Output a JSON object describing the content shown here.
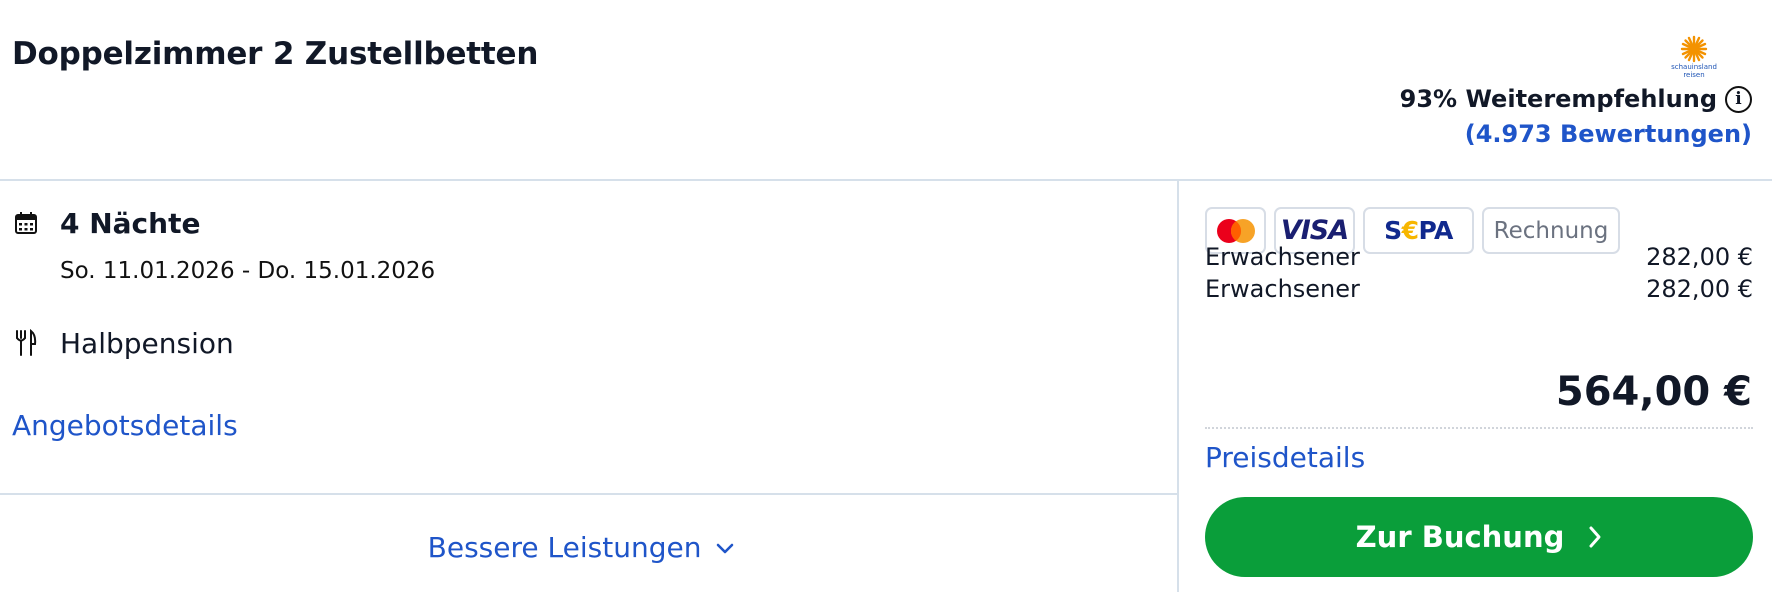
{
  "room": {
    "title": "Doppelzimmer 2 Zustellbetten"
  },
  "provider": {
    "logo_text": "schauinsland reisen",
    "logo_color": "#f39200"
  },
  "rating": {
    "recommendation": "93% Weiterempfehlung",
    "reviews": "(4.973 Bewertungen)",
    "info_icon": "info-icon"
  },
  "stay": {
    "nights": "4 Nächte",
    "dates": "So. 11.01.2026 - Do. 15.01.2026",
    "board": "Halbpension",
    "calendar_icon": "calendar-icon",
    "cutlery_icon": "cutlery-icon"
  },
  "links": {
    "offer_details": "Angebotsdetails",
    "better_services": "Bessere Leistungen",
    "price_details": "Preisdetails"
  },
  "payments": [
    {
      "name": "mastercard",
      "label": ""
    },
    {
      "name": "visa",
      "label": "VISA"
    },
    {
      "name": "sepa",
      "label_s": "S",
      "label_euro": "€",
      "label_pa": "PA"
    },
    {
      "name": "invoice",
      "label": "Rechnung"
    }
  ],
  "prices": {
    "lines": [
      {
        "label": "Erwachsener",
        "amount": "282,00 €"
      },
      {
        "label": "Erwachsener",
        "amount": "282,00 €"
      }
    ],
    "total": "564,00 €"
  },
  "booking": {
    "button_label": "Zur Buchung"
  },
  "colors": {
    "link": "#1f55c9",
    "button": "#0a9e3a",
    "divider": "#d6e0ea"
  }
}
